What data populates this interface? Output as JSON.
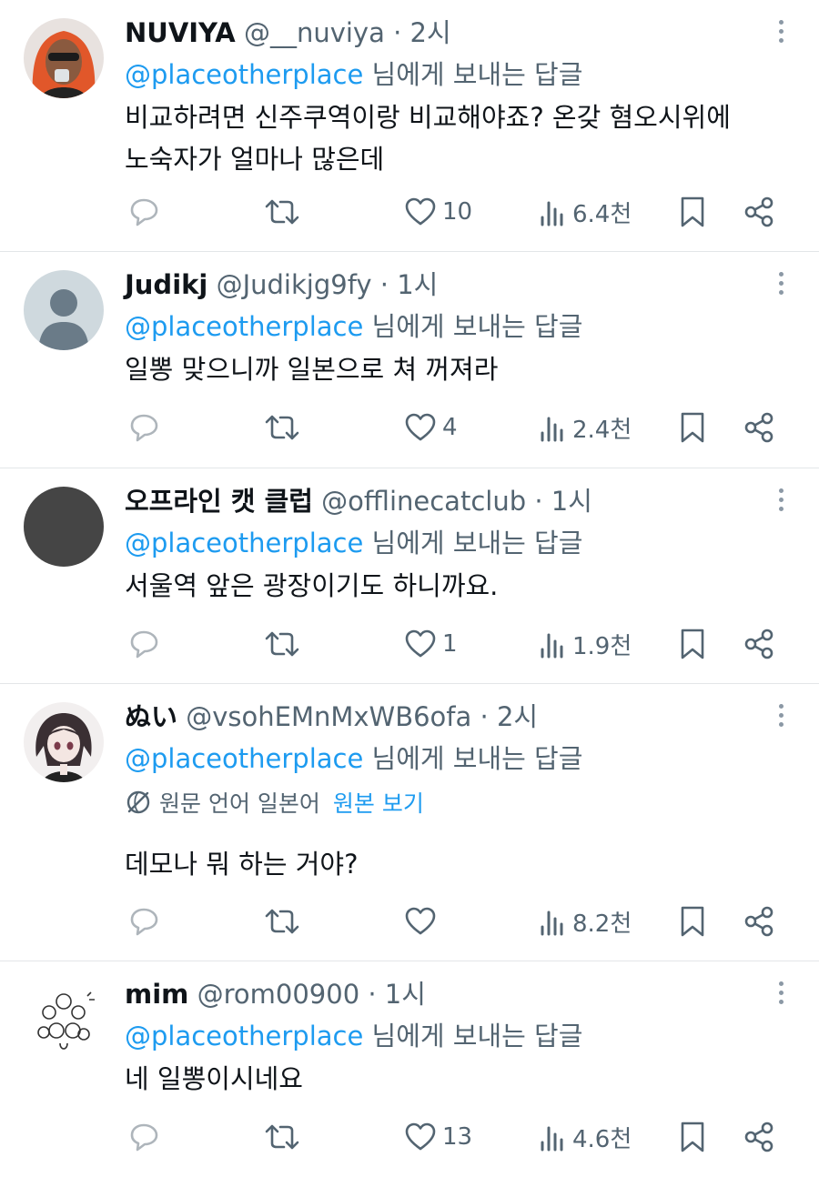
{
  "replies": [
    {
      "name": "NUVIYA",
      "handle": "@__nuviya",
      "time": "2시",
      "reply_to_user": "@placeotherplace",
      "reply_to_suffix": "님에게 보내는 답글",
      "text_lines": [
        "비교하려면 신주쿠역이랑 비교해야죠? 온갖 혐오시위에",
        "노숙자가 얼마나 많은데"
      ],
      "likes": "10",
      "views": "6.4천"
    },
    {
      "name": "Judikj",
      "handle": "@Judikjg9fy",
      "time": "1시",
      "reply_to_user": "@placeotherplace",
      "reply_to_suffix": "님에게 보내는 답글",
      "text_lines": [
        "일뽕 맞으니까 일본으로 쳐 꺼져라"
      ],
      "likes": "4",
      "views": "2.4천"
    },
    {
      "name": "오프라인 캣 클럽",
      "handle": "@offlinecatclub",
      "time": "1시",
      "reply_to_user": "@placeotherplace",
      "reply_to_suffix": "님에게 보내는 답글",
      "text_lines": [
        "서울역 앞은 광장이기도 하니까요."
      ],
      "likes": "1",
      "views": "1.9천"
    },
    {
      "name": "ぬい",
      "handle": "@vsohEMnMxWB6ofa",
      "time": "2시",
      "reply_to_user": "@placeotherplace",
      "reply_to_suffix": "님에게 보내는 답글",
      "translation_note": "원문 언어 일본어",
      "translation_link": "원본 보기",
      "text_lines": [
        "데모나 뭐 하는 거야?"
      ],
      "likes": "",
      "views": "8.2천"
    },
    {
      "name": "mim",
      "handle": "@rom00900",
      "time": "1시",
      "reply_to_user": "@placeotherplace",
      "reply_to_suffix": "님에게 보내는 답글",
      "text_lines": [
        "네 일뽕이시네요"
      ],
      "likes": "13",
      "views": "4.6천"
    }
  ],
  "separator": "·",
  "colors": {
    "link": "#1d9bf0",
    "secondary": "#536471",
    "primary_text": "#0f1419",
    "divider": "#e3e6e8"
  },
  "icons": {
    "reply": "speech-bubble",
    "retweet": "loop-arrows",
    "like": "heart",
    "views": "bar-chart",
    "bookmark": "bookmark",
    "share": "share-nodes",
    "more": "vertical-dots",
    "translate": "globe-slash"
  }
}
